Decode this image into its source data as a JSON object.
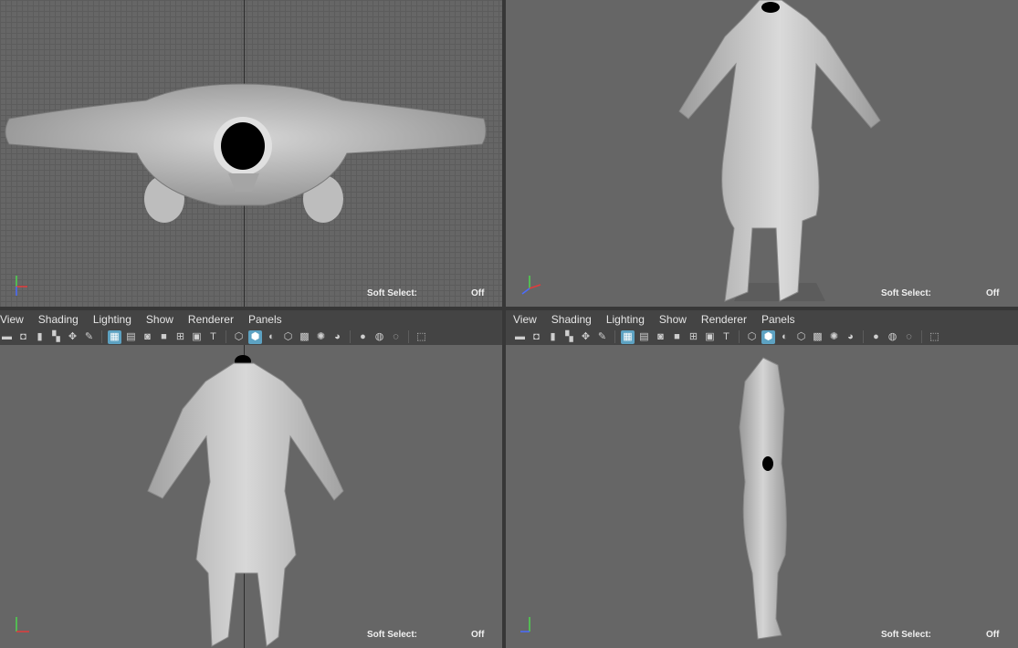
{
  "panels": {
    "menu": [
      "View",
      "Shading",
      "Lighting",
      "Show",
      "Renderer",
      "Panels"
    ]
  },
  "status": {
    "soft_select_label": "Soft Select:",
    "soft_select_value": "Off"
  },
  "axes": {
    "x": "x",
    "y": "y",
    "z": "z"
  },
  "colors": {
    "viewport_bg": "#666666",
    "ui_bg": "#444444",
    "accent": "#5da2c2",
    "model": "#c4c4c4"
  }
}
